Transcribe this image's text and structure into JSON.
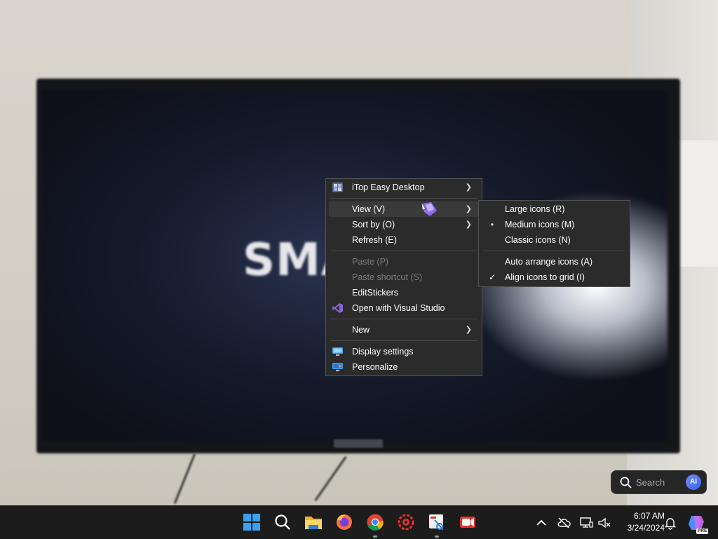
{
  "wallpaper": {
    "tv_text": "SMA"
  },
  "context_menu": {
    "items": [
      {
        "label": "iTop Easy Desktop",
        "icon": "itop-easy-desktop-icon",
        "has_submenu": true
      },
      {
        "label": "View (V)",
        "has_submenu": true,
        "highlighted": true
      },
      {
        "label": "Sort by (O)",
        "has_submenu": true
      },
      {
        "label": "Refresh (E)"
      },
      {
        "label": "Paste (P)",
        "disabled": true
      },
      {
        "label": "Paste shortcut (S)",
        "disabled": true
      },
      {
        "label": "EditStickers"
      },
      {
        "label": "Open with Visual Studio",
        "icon": "visual-studio-icon"
      },
      {
        "label": "New",
        "has_submenu": true
      },
      {
        "label": "Display settings",
        "icon": "display-settings-icon"
      },
      {
        "label": "Personalize",
        "icon": "personalize-icon"
      }
    ]
  },
  "view_submenu": {
    "items": [
      {
        "label": "Large icons (R)"
      },
      {
        "label": "Medium icons (M)",
        "mark": "•"
      },
      {
        "label": "Classic icons (N)"
      },
      {
        "label": "Auto arrange icons (A)"
      },
      {
        "label": "Align icons to grid (I)",
        "mark": "✓"
      }
    ]
  },
  "search": {
    "placeholder": "Search",
    "ai_badge": "AI"
  },
  "taskbar": {
    "apps": [
      "start-icon",
      "search-icon",
      "file-explorer-icon",
      "firefox-icon",
      "chrome-icon",
      "red-gear-app-icon",
      "snipping-tool-icon",
      "screen-recorder-icon"
    ],
    "clock": {
      "time": "6:07 AM",
      "date": "3/24/2024"
    },
    "copilot_badge": "PRE"
  },
  "colors": {
    "menu_bg": "#2b2b2b",
    "menu_hover": "#3a3a3a",
    "taskbar_bg": "#1c1c1c",
    "windows_blue": "#3aa0f0"
  }
}
